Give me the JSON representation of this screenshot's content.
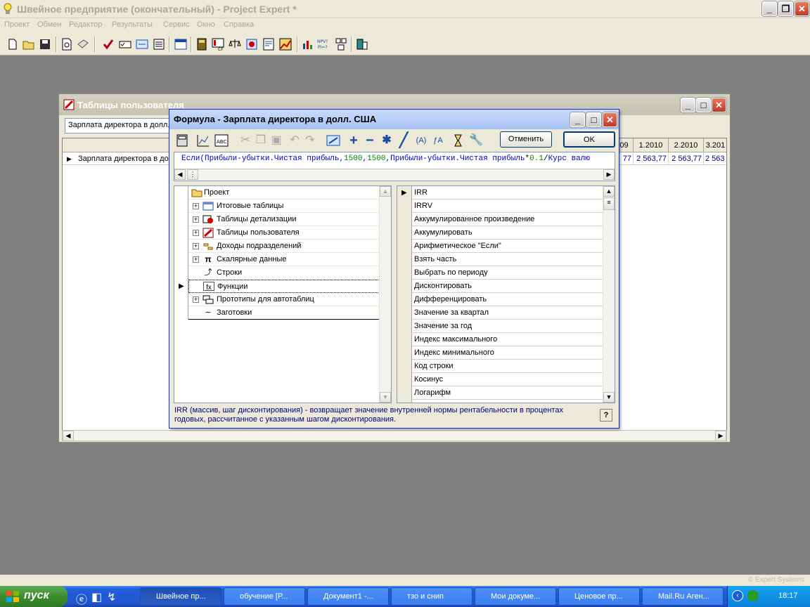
{
  "main_window": {
    "title": "Швейное предприятие (окончательный) - Project Expert *",
    "menu": [
      "Проект",
      "Обмен",
      "Редактор",
      "Результаты",
      "Сервис",
      "Окно",
      "Справка"
    ]
  },
  "user_tables_window": {
    "title": "Таблицы пользователя",
    "selector_value": "Зарплата директора в долл. С",
    "columns": [
      "09",
      "1.2010",
      "2.2010",
      "3.201"
    ],
    "row_label": "Зарплата директора в до",
    "row_values": [
      "77",
      "2 563,77",
      "2 563,77",
      "2 563"
    ]
  },
  "formula_dialog": {
    "title": "Формула - Зарплата директора в долл. США",
    "cancel_label": "Отменить",
    "ok_label": "OK",
    "formula_parts": {
      "f1": "Если(",
      "f2": "Прибыли-убытки.Чистая прибыль",
      "f3": ",",
      "f4": "1500",
      "f5": ",",
      "f6": "1500",
      "f7": ",",
      "f8": "Прибыли-убытки.Чистая прибыль",
      "f9": "*",
      "f10": "0.1",
      "f11": "/",
      "f12": "Курс валю"
    },
    "tree": [
      {
        "label": "Проект",
        "expander": false,
        "icon": "folder-icon"
      },
      {
        "label": "Итоговые таблицы",
        "expander": true,
        "icon": "table-icon"
      },
      {
        "label": "Таблицы детализации",
        "expander": true,
        "icon": "detail-table-icon"
      },
      {
        "label": "Таблицы пользователя",
        "expander": true,
        "icon": "user-table-icon"
      },
      {
        "label": "Доходы подразделений",
        "expander": true,
        "icon": "income-icon"
      },
      {
        "label": "Скалярные данные",
        "expander": true,
        "icon": "pi-icon"
      },
      {
        "label": "Строки",
        "expander": false,
        "icon": "rows-icon"
      },
      {
        "label": "Функции",
        "expander": false,
        "icon": "function-icon"
      },
      {
        "label": "Прототипы для автотаблиц",
        "expander": true,
        "icon": "prototype-icon"
      },
      {
        "label": "Заготовки",
        "expander": false,
        "icon": "template-icon"
      }
    ],
    "functions": [
      "IRR",
      "IRRV",
      "Аккумулированное произведение",
      "Аккумулировать",
      "Арифметическое \"Если\"",
      "Взять часть",
      "Выбрать по периоду",
      "Дисконтировать",
      "Дифференцировать",
      "Значение за квартал",
      "Значение за год",
      "Индекс максимального",
      "Индекс минимального",
      "Код строки",
      "Косинус",
      "Логарифм"
    ],
    "description": "IRR (массив, шаг дисконтирования) - возвращает  значение внутренней нормы рентабельности в процентах годовых, рассчитанное с указанным шагом дисконтирования."
  },
  "brand": "© Expert Systems",
  "taskbar": {
    "start_label": "пуск",
    "buttons": [
      "Швейное пр...",
      "обучение [Р...",
      "Документ1 -...",
      "тзо и снип",
      "Мои докуме...",
      "Ценовое пр...",
      "Mail.Ru Аген..."
    ],
    "lang": "RU",
    "time": "18:17"
  },
  "colors": {
    "formula_text": "#0000c0",
    "formula_number": "#008000",
    "description_text": "#000080",
    "taskbar_blue": "#245edb",
    "start_green": "#3c8d2e"
  }
}
